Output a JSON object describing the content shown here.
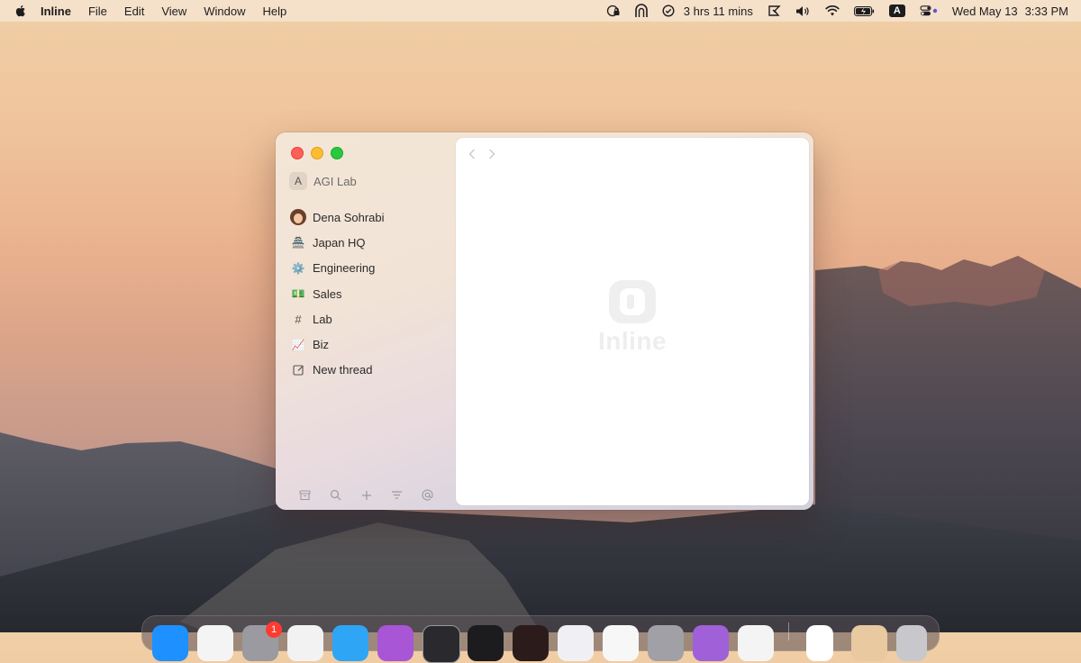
{
  "menubar": {
    "app_name": "Inline",
    "menus": [
      "File",
      "Edit",
      "View",
      "Window",
      "Help"
    ],
    "status": {
      "timer": "3 hrs 11 mins",
      "keyboard_badge": "A",
      "date": "Wed May 13",
      "time": "3:33 PM"
    }
  },
  "window": {
    "space": {
      "avatar_letter": "A",
      "name": "AGI Lab"
    },
    "threads": [
      {
        "label": "Dena Sohrabi",
        "icon": "user-avatar"
      },
      {
        "label": "Japan HQ",
        "icon": "🏯"
      },
      {
        "label": "Engineering",
        "icon": "⚙️"
      },
      {
        "label": "Sales",
        "icon": "💵"
      },
      {
        "label": "Lab",
        "icon": "#"
      },
      {
        "label": "Biz",
        "icon": "📈"
      },
      {
        "label": "New thread",
        "icon": "compose-icon"
      }
    ],
    "footer_icons": [
      "archive-icon",
      "search-icon",
      "plus-icon",
      "filter-icon",
      "at-icon"
    ],
    "content": {
      "logo_text": "Inline"
    }
  },
  "dock": {
    "badge_count": "1"
  },
  "colors": {
    "close": "#ff5f57",
    "minimize": "#febc2e",
    "maximize": "#28c840",
    "badge": "#ff3b30"
  }
}
